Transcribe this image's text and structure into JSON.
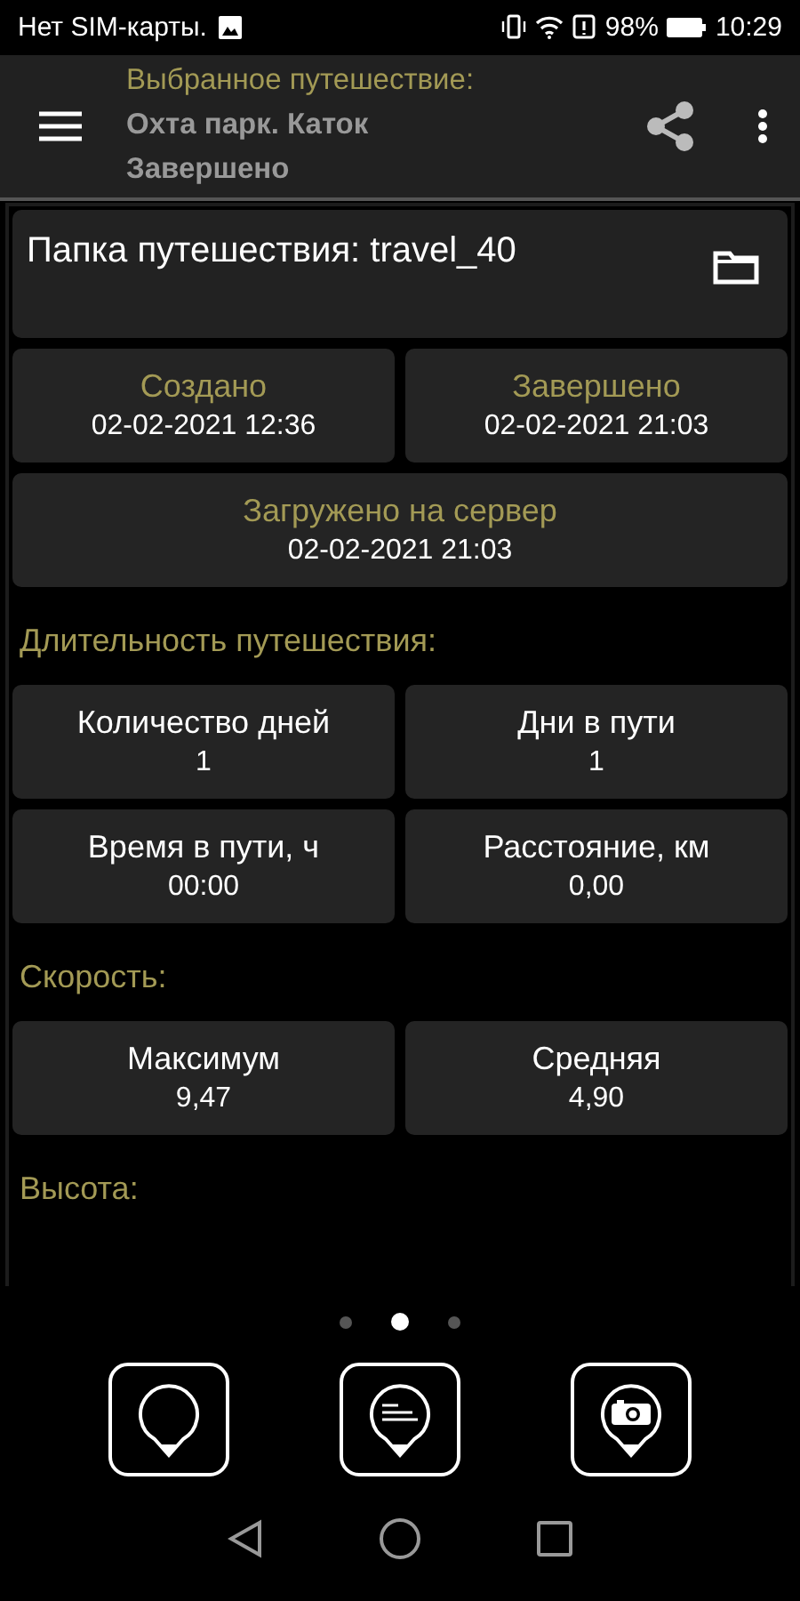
{
  "status_bar": {
    "carrier": "Нет SIM-карты.",
    "battery": "98%",
    "time": "10:29"
  },
  "toolbar": {
    "caption": "Выбранное путешествие:",
    "title": "Охта парк. Каток",
    "status": "Завершено"
  },
  "folder": {
    "label": "Папка путешествия: travel_40"
  },
  "sections": [
    {
      "rows": [
        [
          {
            "kind": "date",
            "label": "Создано",
            "value": "02-02-2021 12:36"
          },
          {
            "kind": "date",
            "label": "Завершено",
            "value": "02-02-2021 21:03"
          }
        ],
        [
          {
            "kind": "date",
            "label": "Загружено на сервер",
            "value": "02-02-2021 21:03"
          }
        ]
      ]
    },
    {
      "heading": "Длительность путешествия:",
      "rows": [
        [
          {
            "kind": "stat",
            "label": "Количество дней",
            "value": "1"
          },
          {
            "kind": "stat",
            "label": "Дни в пути",
            "value": "1"
          }
        ],
        [
          {
            "kind": "stat",
            "label": "Время в пути, ч",
            "value": "00:00"
          },
          {
            "kind": "stat",
            "label": "Расстояние, км",
            "value": "0,00"
          }
        ]
      ]
    },
    {
      "heading": "Скорость:",
      "rows": [
        [
          {
            "kind": "stat",
            "label": "Максимум",
            "value": "9,47"
          },
          {
            "kind": "stat",
            "label": "Средняя",
            "value": "4,90"
          }
        ]
      ]
    },
    {
      "heading": "Высота:"
    }
  ],
  "pager": [
    {
      "selected": false
    },
    {
      "selected": true
    },
    {
      "selected": false
    }
  ],
  "actions": [
    {
      "kind": "pin"
    },
    {
      "kind": "notes"
    },
    {
      "kind": "camera"
    }
  ]
}
